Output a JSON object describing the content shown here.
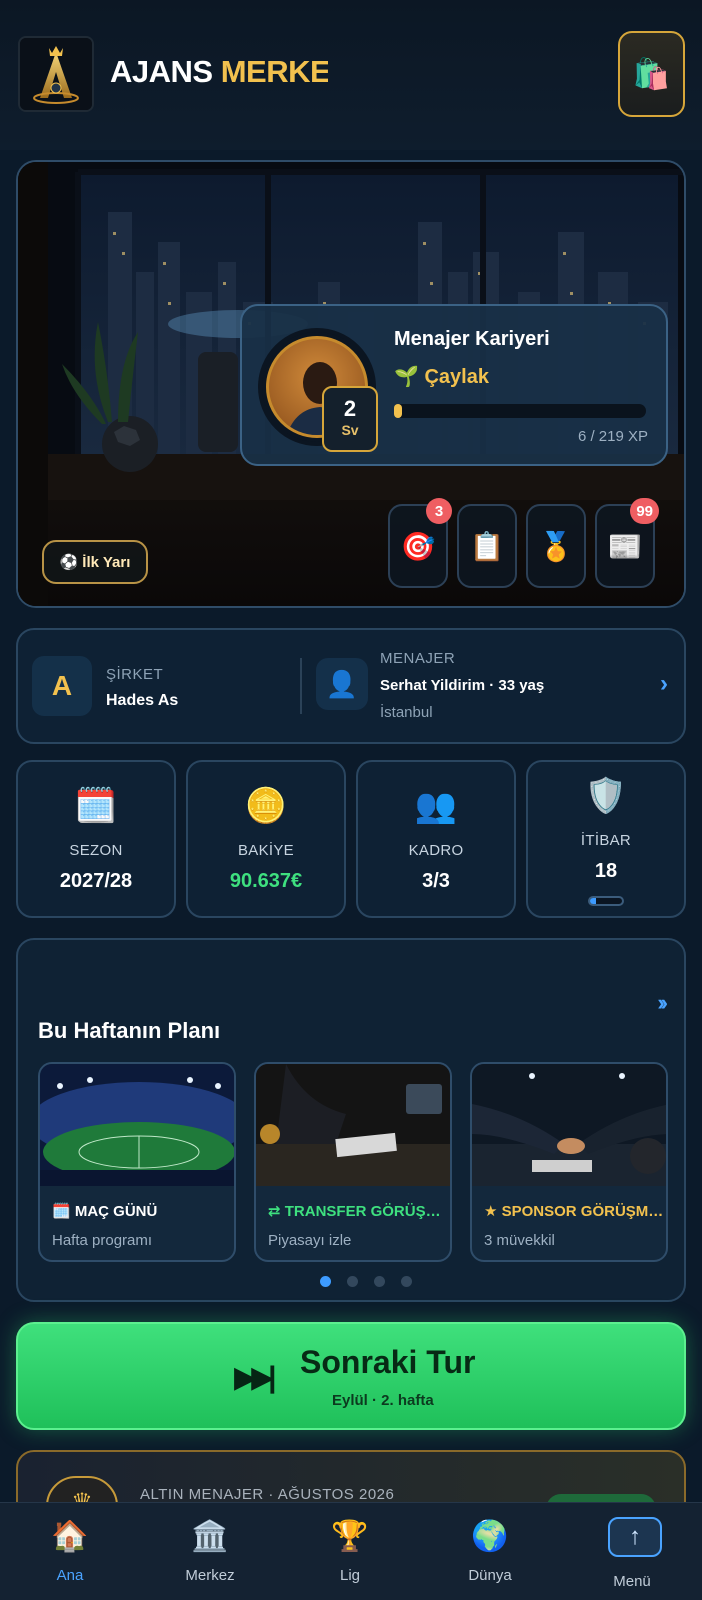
{
  "app": {
    "title_part1": "AJANS",
    "title_part2": "MERKE"
  },
  "header": {
    "shop_icon": "shopping-bag-icon"
  },
  "hero": {
    "half_button_icon": "⚽",
    "half_button_label": "İlk Yarı",
    "career": {
      "title": "Menajer Kariyeri",
      "rank_icon": "🌱",
      "rank": "Çaylak",
      "level": "2",
      "level_unit": "Sv",
      "xp_text": "6 / 219 XP",
      "xp_current": 6,
      "xp_max": 219
    },
    "quick_buttons": [
      {
        "icon": "🎯",
        "name": "target-icon",
        "badge": "3"
      },
      {
        "icon": "📋",
        "name": "clipboard-icon",
        "badge": ""
      },
      {
        "icon": "🏅",
        "name": "medal-icon",
        "badge": ""
      },
      {
        "icon": "📰",
        "name": "newspaper-icon",
        "badge": "99"
      }
    ]
  },
  "info": {
    "company_letter": "A",
    "company_label": "ŞİRKET",
    "company_name": "Hades As",
    "manager_icon": "👤",
    "manager_label": "MENAJER",
    "manager_name": "Serhat Yildirim · 33 yaş",
    "manager_city": "İstanbul",
    "chevron": "›"
  },
  "stats": [
    {
      "icon": "🗓️",
      "label": "SEZON",
      "value": "2027/28"
    },
    {
      "icon": "🪙",
      "label": "BAKİYE",
      "value": "90.637€"
    },
    {
      "icon": "👥",
      "label": "KADRO",
      "value": "3/3"
    },
    {
      "icon": "🛡️",
      "label": "İTİBAR",
      "value": "18",
      "level_fraction": 0.18
    }
  ],
  "plan": {
    "title": "Bu Haftanın Planı",
    "more": "››",
    "cards": [
      {
        "title": "🗓️ MAÇ GÜNÜ",
        "subtitle": "Hafta programı",
        "color": "#ffffff"
      },
      {
        "title": "⇄ TRANSFER GÖRÜŞMELERİ",
        "subtitle": "Piyasayı izle",
        "color": "#3ee07f"
      },
      {
        "title": "★ SPONSOR GÖRÜŞMELERİ",
        "subtitle": "3 müvekkil",
        "color": "#f2c14e"
      }
    ],
    "page_count": 4,
    "active_page": 0
  },
  "next_turn": {
    "icon": "⏭",
    "title": "Sonraki Tur",
    "subtitle": "Eylül · 2. hafta"
  },
  "gold_card": {
    "icon": "♛",
    "text": "ALTIN MENAJER · AĞUSTOS 2026"
  },
  "nav": [
    {
      "icon": "🏠",
      "label": "Ana",
      "name": "nav-home"
    },
    {
      "icon": "🏛️",
      "label": "Merkez",
      "name": "nav-center"
    },
    {
      "icon": "🏆",
      "label": "Lig",
      "name": "nav-league"
    },
    {
      "icon": "🌍",
      "label": "Dünya",
      "name": "nav-world"
    },
    {
      "icon": "↑",
      "label": "Menü",
      "name": "nav-menu"
    }
  ],
  "colors": {
    "background": "#0b1a2a",
    "accent_gold": "#f2c14e",
    "accent_blue": "#4aa3ff",
    "accent_green": "#3ee07f",
    "badge_red": "#ef5e62"
  }
}
